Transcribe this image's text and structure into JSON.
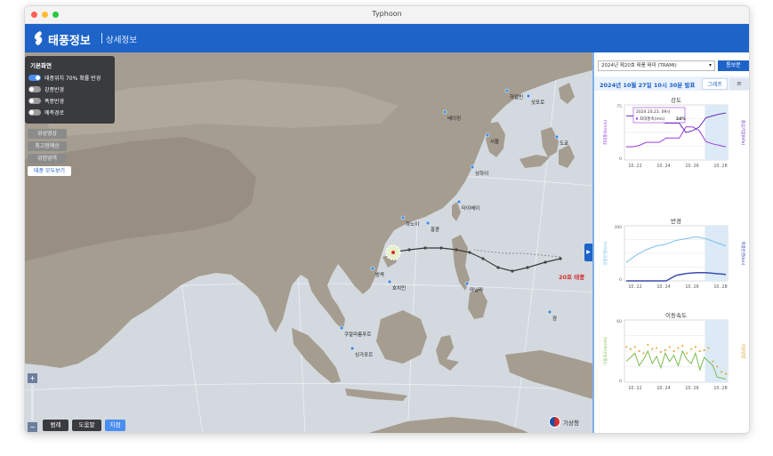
{
  "window": {
    "title": "Typhoon"
  },
  "header": {
    "brand": "태풍정보",
    "section": "상세정보"
  },
  "layer_panel": {
    "title": "기본화면",
    "toggles": [
      {
        "label": "태풍위치 70% 확률 반경",
        "on": true
      },
      {
        "label": "강풍반경",
        "on": false
      },
      {
        "label": "폭풍반경",
        "on": false
      },
      {
        "label": "예측경로",
        "on": false
      }
    ]
  },
  "layer_buttons": [
    "위성영상",
    "최고점예상",
    "위험영역"
  ],
  "all_typhoons_button": "태풍 모두보기",
  "bottom_buttons": [
    {
      "label": "범례",
      "active": false
    },
    {
      "label": "도움말",
      "active": false
    },
    {
      "label": "지점",
      "active": true
    }
  ],
  "zoom": {
    "in": "+",
    "out": "−"
  },
  "map": {
    "typhoon_label": "20호 태풍",
    "cities": [
      {
        "name": "하얼빈"
      },
      {
        "name": "삿포로"
      },
      {
        "name": "베이징"
      },
      {
        "name": "서울"
      },
      {
        "name": "도쿄"
      },
      {
        "name": "상하이"
      },
      {
        "name": "타이베이"
      },
      {
        "name": "홍콩"
      },
      {
        "name": "하노이"
      },
      {
        "name": "마닐라"
      },
      {
        "name": "방콕"
      },
      {
        "name": "호치민"
      },
      {
        "name": "쿠알라룸푸르"
      },
      {
        "name": "싱가포르"
      },
      {
        "name": "괌"
      }
    ]
  },
  "agency": {
    "name": "기상청"
  },
  "sidebar": {
    "typhoon_select": "2024년 제20호 태풍 짜미 (TRAMI)",
    "compare_button": "통보문",
    "issued": "2024년 10월 27일 10시 30분 발표",
    "tabs": {
      "graph": "그래프",
      "list": "≡"
    }
  },
  "chart_data": [
    {
      "type": "line",
      "title": "강도",
      "ylabel": "최대풍속(m/s)",
      "y2label": "중심기압(hPa)",
      "x": [
        "10. 22",
        "10. 24",
        "10. 26",
        "10. 28"
      ],
      "ylim": [
        0,
        75
      ],
      "y2lim": [
        870,
        1020
      ],
      "series": [
        {
          "name": "최대풍속",
          "values": [
            18,
            18,
            20,
            24,
            24,
            24,
            30,
            30,
            30,
            45,
            45,
            40,
            25,
            22,
            20,
            18
          ]
        },
        {
          "name": "중심기압",
          "values": [
            990,
            990,
            985,
            975,
            975,
            975,
            970,
            970,
            970,
            945,
            950,
            960,
            985,
            990,
            995,
            998
          ]
        }
      ],
      "tooltip": {
        "date": "2024.10.23. 09시",
        "label": "최대풍속(m/s)",
        "value": "24%"
      },
      "forecast_from": "10. 27"
    },
    {
      "type": "line",
      "title": "반경",
      "ylabel": "강풍반경(km)",
      "y2label": "폭풍반경(km)",
      "x": [
        "10. 22",
        "10. 24",
        "10. 26",
        "10. 28"
      ],
      "ylim": [
        0,
        300
      ],
      "series": [
        {
          "name": "강풍반경",
          "values": [
            100,
            140,
            170,
            190,
            200,
            220,
            230,
            240,
            230,
            210,
            190
          ]
        },
        {
          "name": "폭풍반경",
          "values": [
            0,
            0,
            0,
            0,
            0,
            30,
            40,
            45,
            45,
            40,
            35
          ]
        }
      ],
      "forecast_from": "10. 27"
    },
    {
      "type": "line",
      "title": "이동속도",
      "ylabel": "이동속도(km/h)",
      "y2label": "이동방향",
      "x": [
        "10. 22",
        "10. 24",
        "10. 26",
        "10. 28"
      ],
      "ylim": [
        0,
        60
      ],
      "series": [
        {
          "name": "이동속도",
          "values": [
            20,
            24,
            28,
            16,
            22,
            30,
            18,
            25,
            14,
            28,
            20,
            26,
            16,
            30,
            22,
            18,
            28,
            12,
            24,
            20,
            16,
            5,
            4,
            3
          ]
        },
        {
          "name": "이동방향",
          "values": [
            34,
            32,
            34,
            30,
            28,
            36,
            32,
            33,
            29,
            31,
            34,
            30,
            33,
            35,
            28,
            32,
            34,
            30,
            31,
            33,
            20,
            15,
            10,
            8
          ]
        }
      ],
      "forecast_from": "10. 27"
    }
  ]
}
